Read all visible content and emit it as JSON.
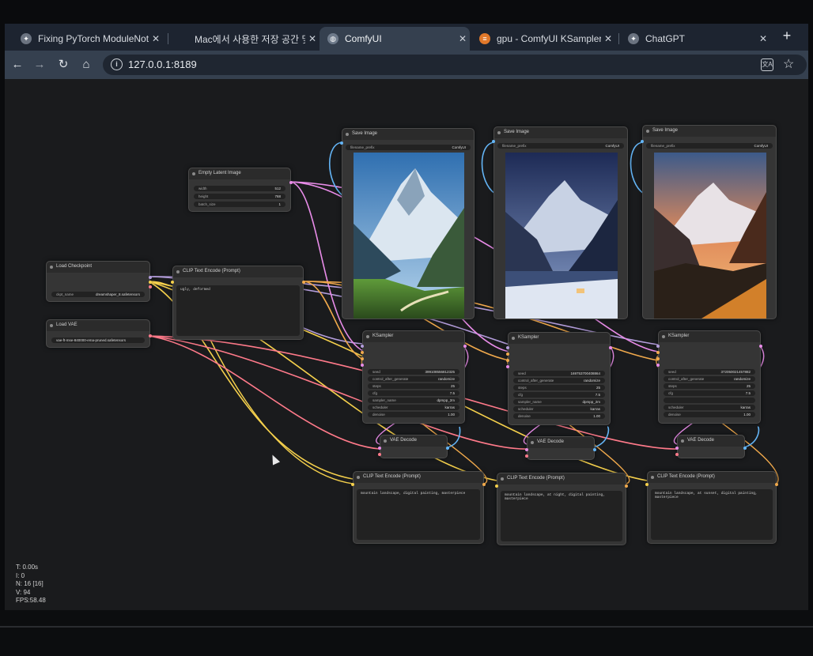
{
  "browser": {
    "tabs": [
      {
        "label": "Fixing PyTorch ModuleNotFou",
        "icon": "chatgpt-icon"
      },
      {
        "label": "Mac에서 사용한 저장 공간 및 사용",
        "icon": "apple-icon"
      },
      {
        "label": "ComfyUI",
        "icon": "globe-icon",
        "active": true
      },
      {
        "label": "gpu - ComfyUI KSampler ste",
        "icon": "stackoverflow-icon"
      },
      {
        "label": "ChatGPT",
        "icon": "chatgpt-icon"
      }
    ],
    "url": "127.0.0.1:8189"
  },
  "nodes": {
    "empty_latent": {
      "title": "Empty Latent Image",
      "widgets": [
        {
          "name": "width",
          "value": "512"
        },
        {
          "name": "height",
          "value": "768"
        },
        {
          "name": "batch_size",
          "value": "1"
        }
      ]
    },
    "load_checkpoint": {
      "title": "Load Checkpoint",
      "ckpt_label": "ckpt_name",
      "ckpt_value": "dreamshaper_8.safetensors"
    },
    "load_vae": {
      "title": "Load VAE",
      "vae_value": "vae-ft-mse-840000-ema-pruned.safetensors"
    },
    "clip_negative": {
      "title": "CLIP Text Encode (Prompt)",
      "text": "ugly, deformed"
    },
    "save_images": [
      {
        "title": "Save Image",
        "prefix_label": "filename_prefix",
        "prefix": "ComfyUI"
      },
      {
        "title": "Save Image",
        "prefix_label": "filename_prefix",
        "prefix": "ComfyUI"
      },
      {
        "title": "Save Image",
        "prefix_label": "filename_prefix",
        "prefix": "ComfyUI"
      }
    ],
    "ksamplers": [
      {
        "title": "KSampler",
        "widgets": [
          {
            "name": "seed",
            "value": "399108556812325"
          },
          {
            "name": "control_after_generate",
            "value": "randomize"
          },
          {
            "name": "steps",
            "value": "25"
          },
          {
            "name": "cfg",
            "value": "7.5"
          },
          {
            "name": "sampler_name",
            "value": "dpmpp_2m"
          },
          {
            "name": "scheduler",
            "value": "karras"
          },
          {
            "name": "denoise",
            "value": "1.00"
          }
        ]
      },
      {
        "title": "KSampler",
        "widgets": [
          {
            "name": "seed",
            "value": "169753700408864"
          },
          {
            "name": "control_after_generate",
            "value": "randomize"
          },
          {
            "name": "steps",
            "value": "25"
          },
          {
            "name": "cfg",
            "value": "7.5"
          },
          {
            "name": "sampler_name",
            "value": "dpmpp_2m"
          },
          {
            "name": "scheduler",
            "value": "karras"
          },
          {
            "name": "denoise",
            "value": "1.00"
          }
        ]
      },
      {
        "title": "KSampler",
        "widgets": [
          {
            "name": "seed",
            "value": "372050021457882"
          },
          {
            "name": "control_after_generate",
            "value": "randomize"
          },
          {
            "name": "steps",
            "value": "25"
          },
          {
            "name": "cfg",
            "value": "7.5"
          },
          {
            "name": "scheduler",
            "value": "karras"
          },
          {
            "name": "denoise",
            "value": "1.00"
          }
        ]
      }
    ],
    "vae_decodes": [
      {
        "title": "VAE Decode"
      },
      {
        "title": "VAE Decode"
      },
      {
        "title": "VAE Decode"
      }
    ],
    "clip_positives": [
      {
        "title": "CLIP Text Encode (Prompt)",
        "text": "mountain landscape, digital painting, masterpiece"
      },
      {
        "title": "CLIP Text Encode (Prompt)",
        "text": "mountain landscape, at night, digital painting, masterpiece"
      },
      {
        "title": "CLIP Text Encode (Prompt)",
        "text": "mountain landscape, at sunset, digital painting, masterpiece"
      }
    ]
  },
  "stats": {
    "t": "T: 0.00s",
    "i": "I: 0",
    "n": "N: 16 [16]",
    "v": "V: 94",
    "fps": "FPS:58.48"
  },
  "colors": {
    "model": "#b39ddb",
    "clip": "#f5d04c",
    "vae": "#ff7a8a",
    "latent": "#e88ce8",
    "conditioning": "#f0a94c",
    "image": "#64b5f6"
  }
}
